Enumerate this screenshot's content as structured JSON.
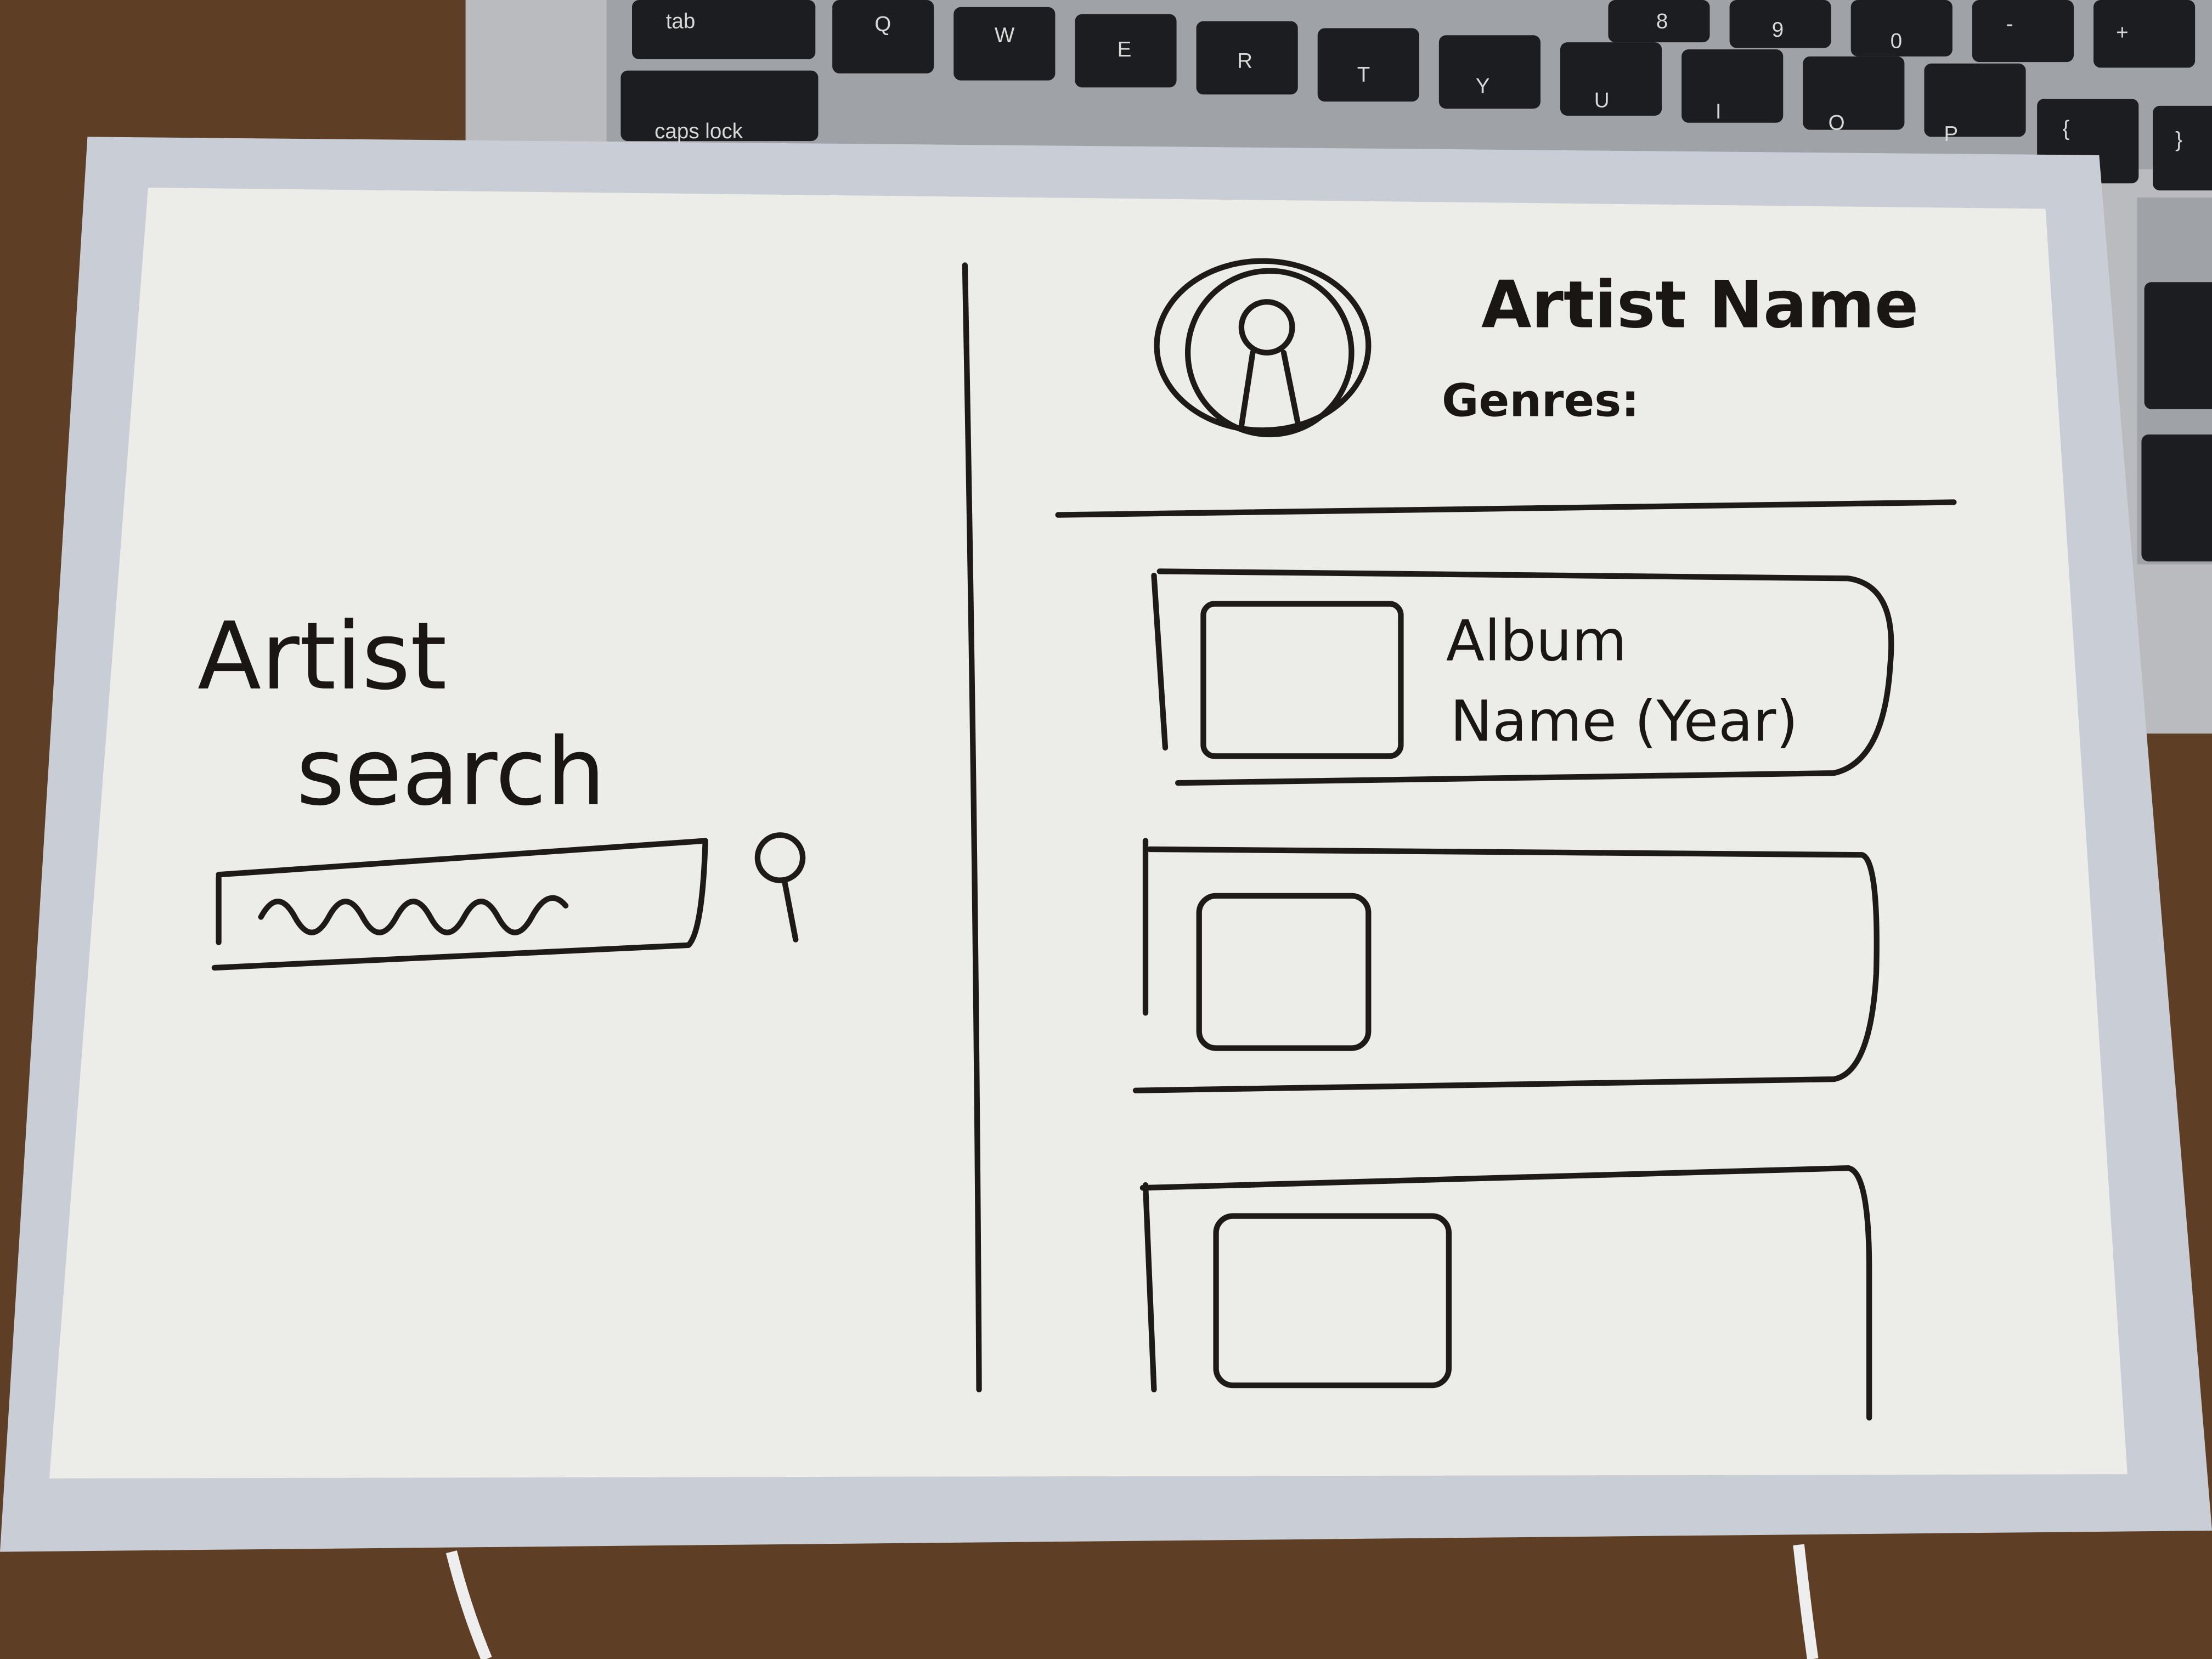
{
  "keyboard": {
    "keys": [
      {
        "label": "tab"
      },
      {
        "label": "Q"
      },
      {
        "label": "W"
      },
      {
        "label": "E"
      },
      {
        "label": "R"
      },
      {
        "label": "T"
      },
      {
        "label": "Y"
      },
      {
        "label": "U"
      },
      {
        "label": "I"
      },
      {
        "label": "O"
      },
      {
        "label": "P"
      },
      {
        "label": "caps lock"
      },
      {
        "label": "8"
      },
      {
        "label": "9"
      },
      {
        "label": "0"
      },
      {
        "label": "-"
      },
      {
        "label": "+"
      },
      {
        "label": "{"
      },
      {
        "label": "}"
      }
    ]
  },
  "search_panel": {
    "title_line1": "Artist",
    "title_line2": "search",
    "search_icon": "search-icon"
  },
  "artist_panel": {
    "artist_name": "Artist Name",
    "genres_label": "Genres:",
    "avatar_icon": "user-avatar-icon",
    "albums": [
      {
        "label_line1": "Album",
        "label_line2": "Name (Year)"
      },
      {
        "label_line1": "",
        "label_line2": ""
      },
      {
        "label_line1": "",
        "label_line2": ""
      }
    ]
  },
  "colors": {
    "board": "#eeeeea",
    "frame": "#c9ced6",
    "ink": "#1e1a18",
    "desk": "#5a3c22"
  }
}
